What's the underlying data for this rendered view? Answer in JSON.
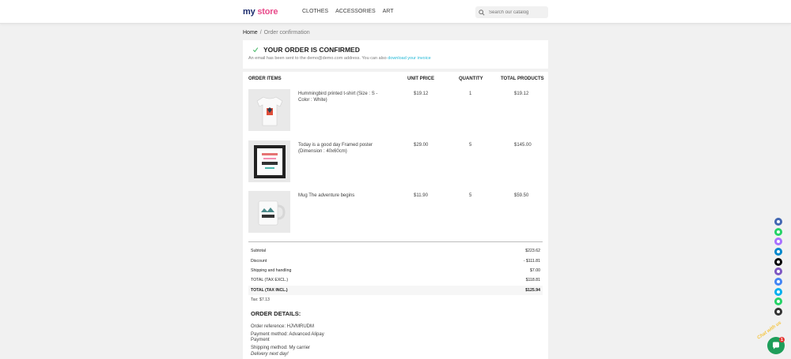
{
  "header": {
    "logo_main": "my",
    "logo_accent": "store",
    "nav": [
      "CLOTHES",
      "ACCESSORIES",
      "ART"
    ],
    "search_placeholder": "Search our catalog"
  },
  "breadcrumb": {
    "home": "Home",
    "sep": "/",
    "current": "Order confirmation"
  },
  "confirmation": {
    "title": "YOUR ORDER IS CONFIRMED",
    "message": "An email has been sent to the demo@demo.com address. You can also",
    "link": "download your invoice"
  },
  "table": {
    "headers": {
      "items": "ORDER ITEMS",
      "unit": "UNIT PRICE",
      "qty": "QUANTITY",
      "total": "TOTAL PRODUCTS"
    },
    "rows": [
      {
        "name": "Hummingbird printed t-shirt (Size : S - Color : White)",
        "unit": "$19.12",
        "qty": "1",
        "total": "$19.12",
        "image": "tshirt"
      },
      {
        "name": "Today is a good day Framed poster (Dimension : 40x60cm)",
        "unit": "$29.00",
        "qty": "5",
        "total": "$145.00",
        "image": "poster"
      },
      {
        "name": "Mug The adventure begins",
        "unit": "$11.90",
        "qty": "5",
        "total": "$59.50",
        "image": "mug"
      }
    ]
  },
  "summary": [
    {
      "label": "Subtotal",
      "value": "$223.62"
    },
    {
      "label": "Discount",
      "value": "- $111.81"
    },
    {
      "label": "Shipping and handling",
      "value": "$7.00"
    },
    {
      "label": "TOTAL (TAX EXCL.)",
      "value": "$118.81"
    },
    {
      "label": "TOTAL (TAX INCL.)",
      "value": "$125.94"
    }
  ],
  "tax": "Tax: $7.13",
  "details": {
    "title": "ORDER DETAILS:",
    "reference": "Order reference: HJVMRUDM",
    "payment": "Payment method: Advanced Alipay",
    "payment2": "Payment",
    "shipping": "Shipping method: My carrier",
    "delivery": "Delivery next day!"
  },
  "social_colors": [
    "#4267b2",
    "#25d366",
    "#a970ff",
    "#0088cc",
    "#000000",
    "#7e57c2",
    "#4285f4",
    "#00aff0",
    "#25d366",
    "#333333"
  ],
  "chat": {
    "badge": "1",
    "label": "Chat with us"
  },
  "colors": {
    "accent": "#24b9d7",
    "check": "#4cbb6c"
  }
}
